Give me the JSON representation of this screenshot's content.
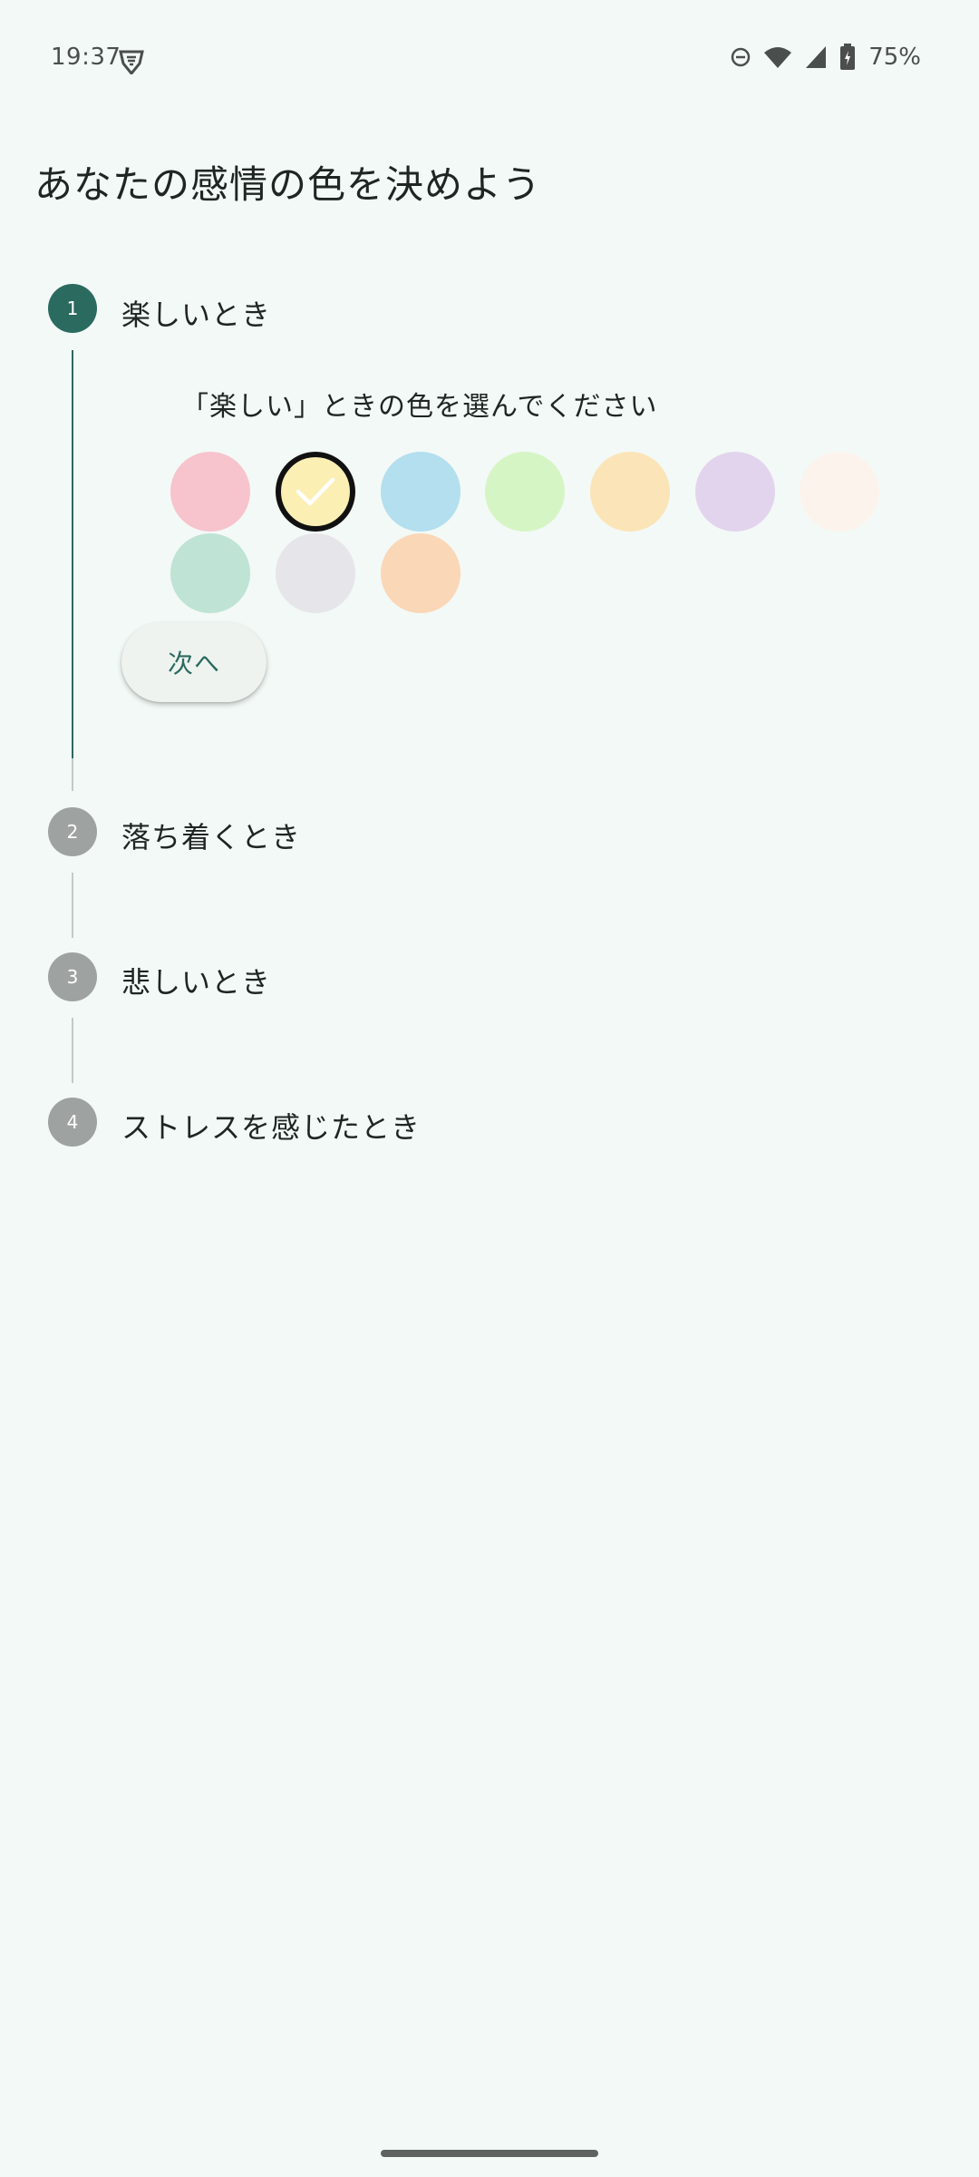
{
  "status_bar": {
    "time": "19:37",
    "battery": "75%",
    "icons": [
      "vpn-shield-icon",
      "dnd-icon",
      "wifi-icon",
      "cell-signal-icon",
      "battery-icon"
    ]
  },
  "page": {
    "title": "あなたの感情の色を決めよう"
  },
  "steps": [
    {
      "number": "1",
      "label": "楽しいとき",
      "state": "active"
    },
    {
      "number": "2",
      "label": "落ち着くとき",
      "state": "inactive"
    },
    {
      "number": "3",
      "label": "悲しいとき",
      "state": "inactive"
    },
    {
      "number": "4",
      "label": "ストレスを感じたとき",
      "state": "inactive"
    }
  ],
  "step1_content": {
    "prompt": "「楽しい」ときの色を選んでください",
    "selected_index": 1,
    "colors": [
      "#F7C3CD",
      "#FCEFB4",
      "#B3DFEF",
      "#D6F5C5",
      "#FBE4B7",
      "#E3D4EE",
      "#FCF4EC",
      "#BFE3D5",
      "#E6E6EA",
      "#FAD7B6"
    ],
    "next_label": "次へ"
  },
  "theme": {
    "background": "#F3F9F6",
    "accent": "#2B6A5F",
    "inactive_step": "#9EA3A1"
  }
}
